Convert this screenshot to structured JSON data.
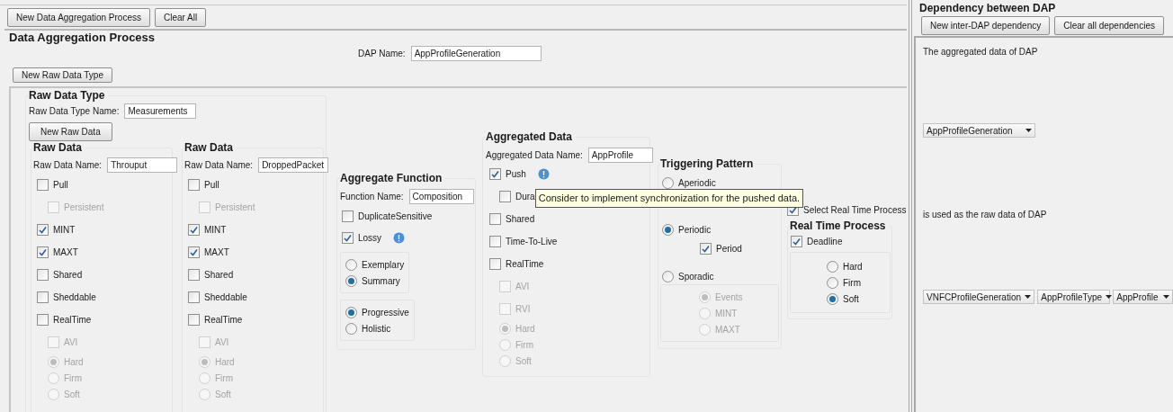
{
  "toolbar": {
    "buttons": [
      "New Data Aggregation Process",
      "Clear All"
    ]
  },
  "dap": {
    "title": "Data Aggregation Process",
    "name_label": "DAP Name:",
    "name_value": "AppProfileGeneration",
    "new_raw_data_type_button": "New Raw Data Type"
  },
  "raw_data_type": {
    "title": "Raw Data Type",
    "name_label": "Raw Data Type Name:",
    "name_value": "Measurements",
    "new_raw_data_button": "New Raw Data",
    "raw_data": [
      {
        "title": "Raw Data",
        "name_label": "Raw Data Name:",
        "name_value": "Throuput",
        "options": [
          {
            "kind": "checkbox",
            "label": "Pull",
            "checked": false,
            "disabled": false,
            "children": [
              {
                "kind": "checkbox",
                "label": "Persistent",
                "checked": false,
                "disabled": true
              }
            ]
          },
          {
            "kind": "checkbox",
            "label": "MINT",
            "checked": true,
            "disabled": false
          },
          {
            "kind": "checkbox",
            "label": "MAXT",
            "checked": true,
            "disabled": false
          },
          {
            "kind": "checkbox",
            "label": "Shared",
            "checked": false,
            "disabled": false
          },
          {
            "kind": "checkbox",
            "label": "Sheddable",
            "checked": false,
            "disabled": false
          },
          {
            "kind": "checkbox",
            "label": "RealTime",
            "checked": false,
            "disabled": false,
            "children": [
              {
                "kind": "checkbox",
                "label": "AVI",
                "checked": false,
                "disabled": true
              },
              {
                "kind": "radio",
                "label": "Hard",
                "selected": true,
                "disabled": true
              },
              {
                "kind": "radio",
                "label": "Firm",
                "selected": false,
                "disabled": true
              },
              {
                "kind": "radio",
                "label": "Soft",
                "selected": false,
                "disabled": true
              }
            ]
          }
        ]
      },
      {
        "title": "Raw Data",
        "name_label": "Raw Data Name:",
        "name_value": "DroppedPacket",
        "options": [
          {
            "kind": "checkbox",
            "label": "Pull",
            "checked": false,
            "disabled": false,
            "children": [
              {
                "kind": "checkbox",
                "label": "Persistent",
                "checked": false,
                "disabled": true
              }
            ]
          },
          {
            "kind": "checkbox",
            "label": "MINT",
            "checked": true,
            "disabled": false
          },
          {
            "kind": "checkbox",
            "label": "MAXT",
            "checked": true,
            "disabled": false
          },
          {
            "kind": "checkbox",
            "label": "Shared",
            "checked": false,
            "disabled": false
          },
          {
            "kind": "checkbox",
            "label": "Sheddable",
            "checked": false,
            "disabled": false
          },
          {
            "kind": "checkbox",
            "label": "RealTime",
            "checked": false,
            "disabled": false,
            "children": [
              {
                "kind": "checkbox",
                "label": "AVI",
                "checked": false,
                "disabled": true
              },
              {
                "kind": "radio",
                "label": "Hard",
                "selected": true,
                "disabled": true
              },
              {
                "kind": "radio",
                "label": "Firm",
                "selected": false,
                "disabled": true
              },
              {
                "kind": "radio",
                "label": "Soft",
                "selected": false,
                "disabled": true
              }
            ]
          }
        ]
      }
    ]
  },
  "aggregate_function": {
    "title": "Aggregate Function",
    "name_label": "Function Name:",
    "name_value": "Composition",
    "options": [
      {
        "kind": "checkbox",
        "label": "DuplicateSensitive",
        "checked": false,
        "disabled": false
      },
      {
        "kind": "checkbox",
        "label": "Lossy",
        "checked": true,
        "disabled": false,
        "info": true
      },
      {
        "kind": "radio_group",
        "children": [
          {
            "kind": "radio",
            "label": "Exemplary",
            "selected": false,
            "disabled": false
          },
          {
            "kind": "radio",
            "label": "Summary",
            "selected": true,
            "disabled": false
          }
        ]
      },
      {
        "kind": "radio_group",
        "children": [
          {
            "kind": "radio",
            "label": "Progressive",
            "selected": true,
            "disabled": false
          },
          {
            "kind": "radio",
            "label": "Holistic",
            "selected": false,
            "disabled": false
          }
        ]
      }
    ]
  },
  "aggregated_data": {
    "title": "Aggregated Data",
    "name_label": "Aggregated Data Name:",
    "name_value": "AppProfile",
    "options": [
      {
        "kind": "checkbox",
        "label": "Push",
        "checked": true,
        "disabled": false,
        "info": true,
        "children": [
          {
            "kind": "checkbox",
            "label": "Dura",
            "checked": false,
            "disabled": false,
            "tooltip": "Consider to implement synchronization for the pushed data."
          }
        ]
      },
      {
        "kind": "checkbox",
        "label": "Shared",
        "checked": false,
        "disabled": false
      },
      {
        "kind": "checkbox",
        "label": "Time-To-Live",
        "checked": false,
        "disabled": false
      },
      {
        "kind": "checkbox",
        "label": "RealTime",
        "checked": false,
        "disabled": false,
        "children": [
          {
            "kind": "checkbox",
            "label": "AVI",
            "checked": false,
            "disabled": true
          },
          {
            "kind": "checkbox",
            "label": "RVI",
            "checked": false,
            "disabled": true
          },
          {
            "kind": "radio",
            "label": "Hard",
            "selected": true,
            "disabled": true
          },
          {
            "kind": "radio",
            "label": "Firm",
            "selected": false,
            "disabled": true
          },
          {
            "kind": "radio",
            "label": "Soft",
            "selected": false,
            "disabled": true
          }
        ]
      }
    ]
  },
  "triggering_pattern": {
    "title": "Triggering Pattern",
    "options": [
      {
        "kind": "radio",
        "label": "Aperiodic",
        "selected": false,
        "disabled": false
      },
      {
        "kind": "radio",
        "label": "Periodic",
        "selected": true,
        "disabled": false,
        "children": [
          {
            "kind": "checkbox",
            "label": "Period",
            "checked": true,
            "disabled": false
          }
        ]
      },
      {
        "kind": "radio",
        "label": "Sporadic",
        "selected": false,
        "disabled": false,
        "children": [
          {
            "kind": "radio_group",
            "children": [
              {
                "kind": "radio",
                "label": "Events",
                "selected": true,
                "disabled": true
              },
              {
                "kind": "radio",
                "label": "MINT",
                "selected": false,
                "disabled": true
              },
              {
                "kind": "radio",
                "label": "MAXT",
                "selected": false,
                "disabled": true
              }
            ]
          }
        ]
      }
    ]
  },
  "real_time": {
    "select_label": "Select Real Time Process",
    "select_checked": true,
    "title": "Real Time Process",
    "options": [
      {
        "kind": "checkbox",
        "label": "Deadline",
        "checked": true,
        "disabled": false
      },
      {
        "kind": "radio_group",
        "children": [
          {
            "kind": "radio",
            "label": "Hard",
            "selected": false,
            "disabled": false
          },
          {
            "kind": "radio",
            "label": "Firm",
            "selected": false,
            "disabled": false
          },
          {
            "kind": "radio",
            "label": "Soft",
            "selected": true,
            "disabled": false
          }
        ]
      }
    ]
  },
  "dependency": {
    "title": "Dependency between DAP",
    "buttons": [
      "New inter-DAP dependency",
      "Clear all dependencies"
    ],
    "source_label": "The aggregated data of DAP",
    "source_dropdown": "AppProfileGeneration",
    "target_label": "is used as the raw data of DAP",
    "target_dropdowns": [
      "VNFCProfileGeneration",
      "AppProfileType",
      "AppProfile"
    ]
  }
}
